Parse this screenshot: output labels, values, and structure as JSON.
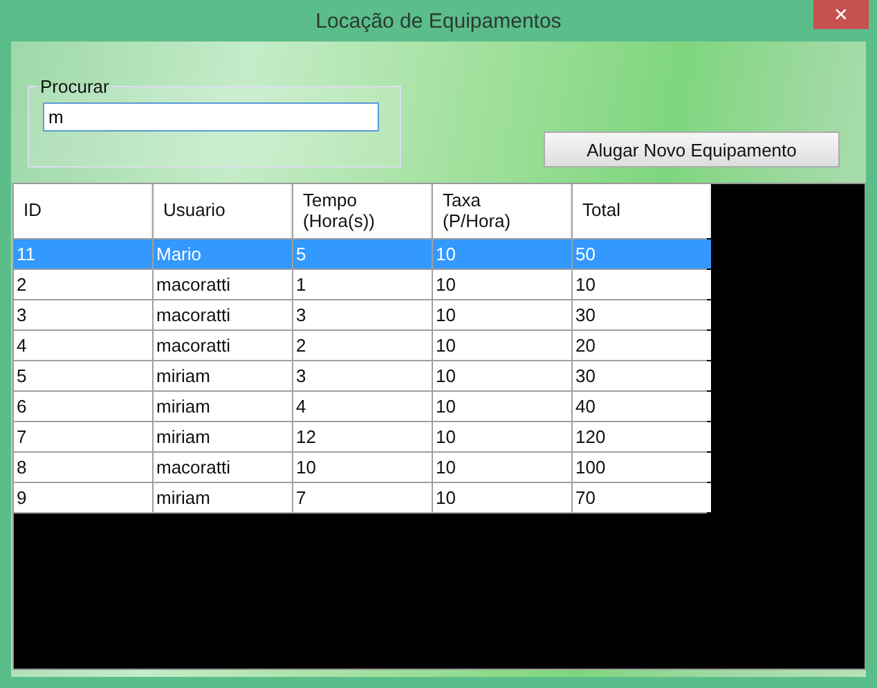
{
  "window": {
    "title": "Locação de Equipamentos",
    "close": "✕"
  },
  "search": {
    "label": "Procurar",
    "value": "m"
  },
  "rent_button": "Alugar Novo Equipamento",
  "table": {
    "columns": [
      "ID",
      "Usuario",
      "Tempo\n(Hora(s))",
      "Taxa\n(P/Hora)",
      "Total"
    ],
    "rows": [
      {
        "cells": [
          "11",
          "Mario",
          "5",
          "10",
          "50"
        ],
        "selected": true
      },
      {
        "cells": [
          "2",
          "macoratti",
          "1",
          "10",
          "10"
        ],
        "selected": false
      },
      {
        "cells": [
          "3",
          "macoratti",
          "3",
          "10",
          "30"
        ],
        "selected": false
      },
      {
        "cells": [
          "4",
          "macoratti",
          "2",
          "10",
          "20"
        ],
        "selected": false
      },
      {
        "cells": [
          "5",
          "miriam",
          "3",
          "10",
          "30"
        ],
        "selected": false
      },
      {
        "cells": [
          "6",
          "miriam",
          "4",
          "10",
          "40"
        ],
        "selected": false
      },
      {
        "cells": [
          "7",
          "miriam",
          "12",
          "10",
          "120"
        ],
        "selected": false
      },
      {
        "cells": [
          "8",
          "macoratti",
          "10",
          "10",
          "100"
        ],
        "selected": false
      },
      {
        "cells": [
          "9",
          "miriam",
          "7",
          "10",
          "70"
        ],
        "selected": false
      }
    ]
  }
}
